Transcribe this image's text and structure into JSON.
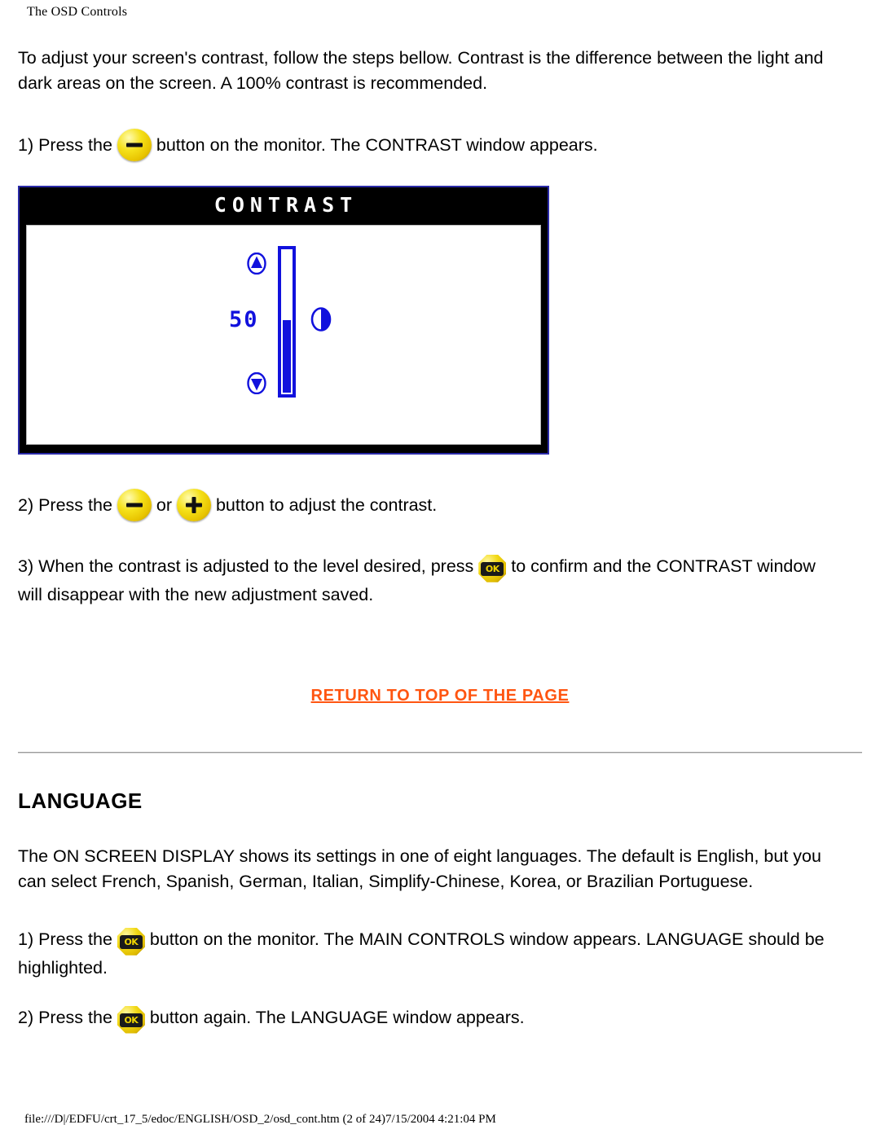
{
  "header": {
    "title": "The OSD Controls"
  },
  "intro": {
    "paragraph": "To adjust your screen's contrast, follow the steps bellow. Contrast is the difference between the light and dark areas on the screen. A 100% contrast is recommended."
  },
  "steps": {
    "step1_before": "1) Press the ",
    "step1_after": " button on the monitor. The CONTRAST window appears.",
    "step2_before": "2) Press the ",
    "step2_middle": " or ",
    "step2_after": " button to adjust the contrast.",
    "step3_before": "3) When the contrast is adjusted to the level desired, press ",
    "step3_after": " to confirm and the CONTRAST window will disappear with the new adjustment saved."
  },
  "osd": {
    "title": "CONTRAST",
    "value": "50",
    "fill_percent": 50,
    "icon_up": "up-arrow-icon",
    "icon_down": "down-arrow-icon",
    "icon_contrast": "contrast-half-circle-icon",
    "colors": {
      "blue": "#1111dd",
      "border": "#2a2aa8",
      "titlebar": "#000000",
      "screen": "#ffffff"
    }
  },
  "buttons": {
    "minus_label": "minus-button",
    "plus_label": "plus-button",
    "ok_label": "OK",
    "colors": {
      "yellow": "#f2d917",
      "yellow_dark": "#b58f00",
      "glyph": "#111111"
    }
  },
  "return_link": {
    "label": "RETURN TO TOP OF THE PAGE",
    "color": "#ff5511"
  },
  "language": {
    "heading": "LANGUAGE",
    "paragraph": "The ON SCREEN DISPLAY shows its settings in one of eight languages. The default is English, but you can select French, Spanish, German, Italian, Simplify-Chinese, Korea, or Brazilian Portuguese.",
    "step1_before": "1) Press the ",
    "step1_after": " button on the monitor. The MAIN CONTROLS window appears. LANGUAGE should be highlighted.",
    "step2_before": "2) Press the ",
    "step2_after": " button again. The LANGUAGE window appears."
  },
  "footer": {
    "path": "file:///D|/EDFU/crt_17_5/edoc/ENGLISH/OSD_2/osd_cont.htm (2 of 24)7/15/2004 4:21:04 PM"
  }
}
